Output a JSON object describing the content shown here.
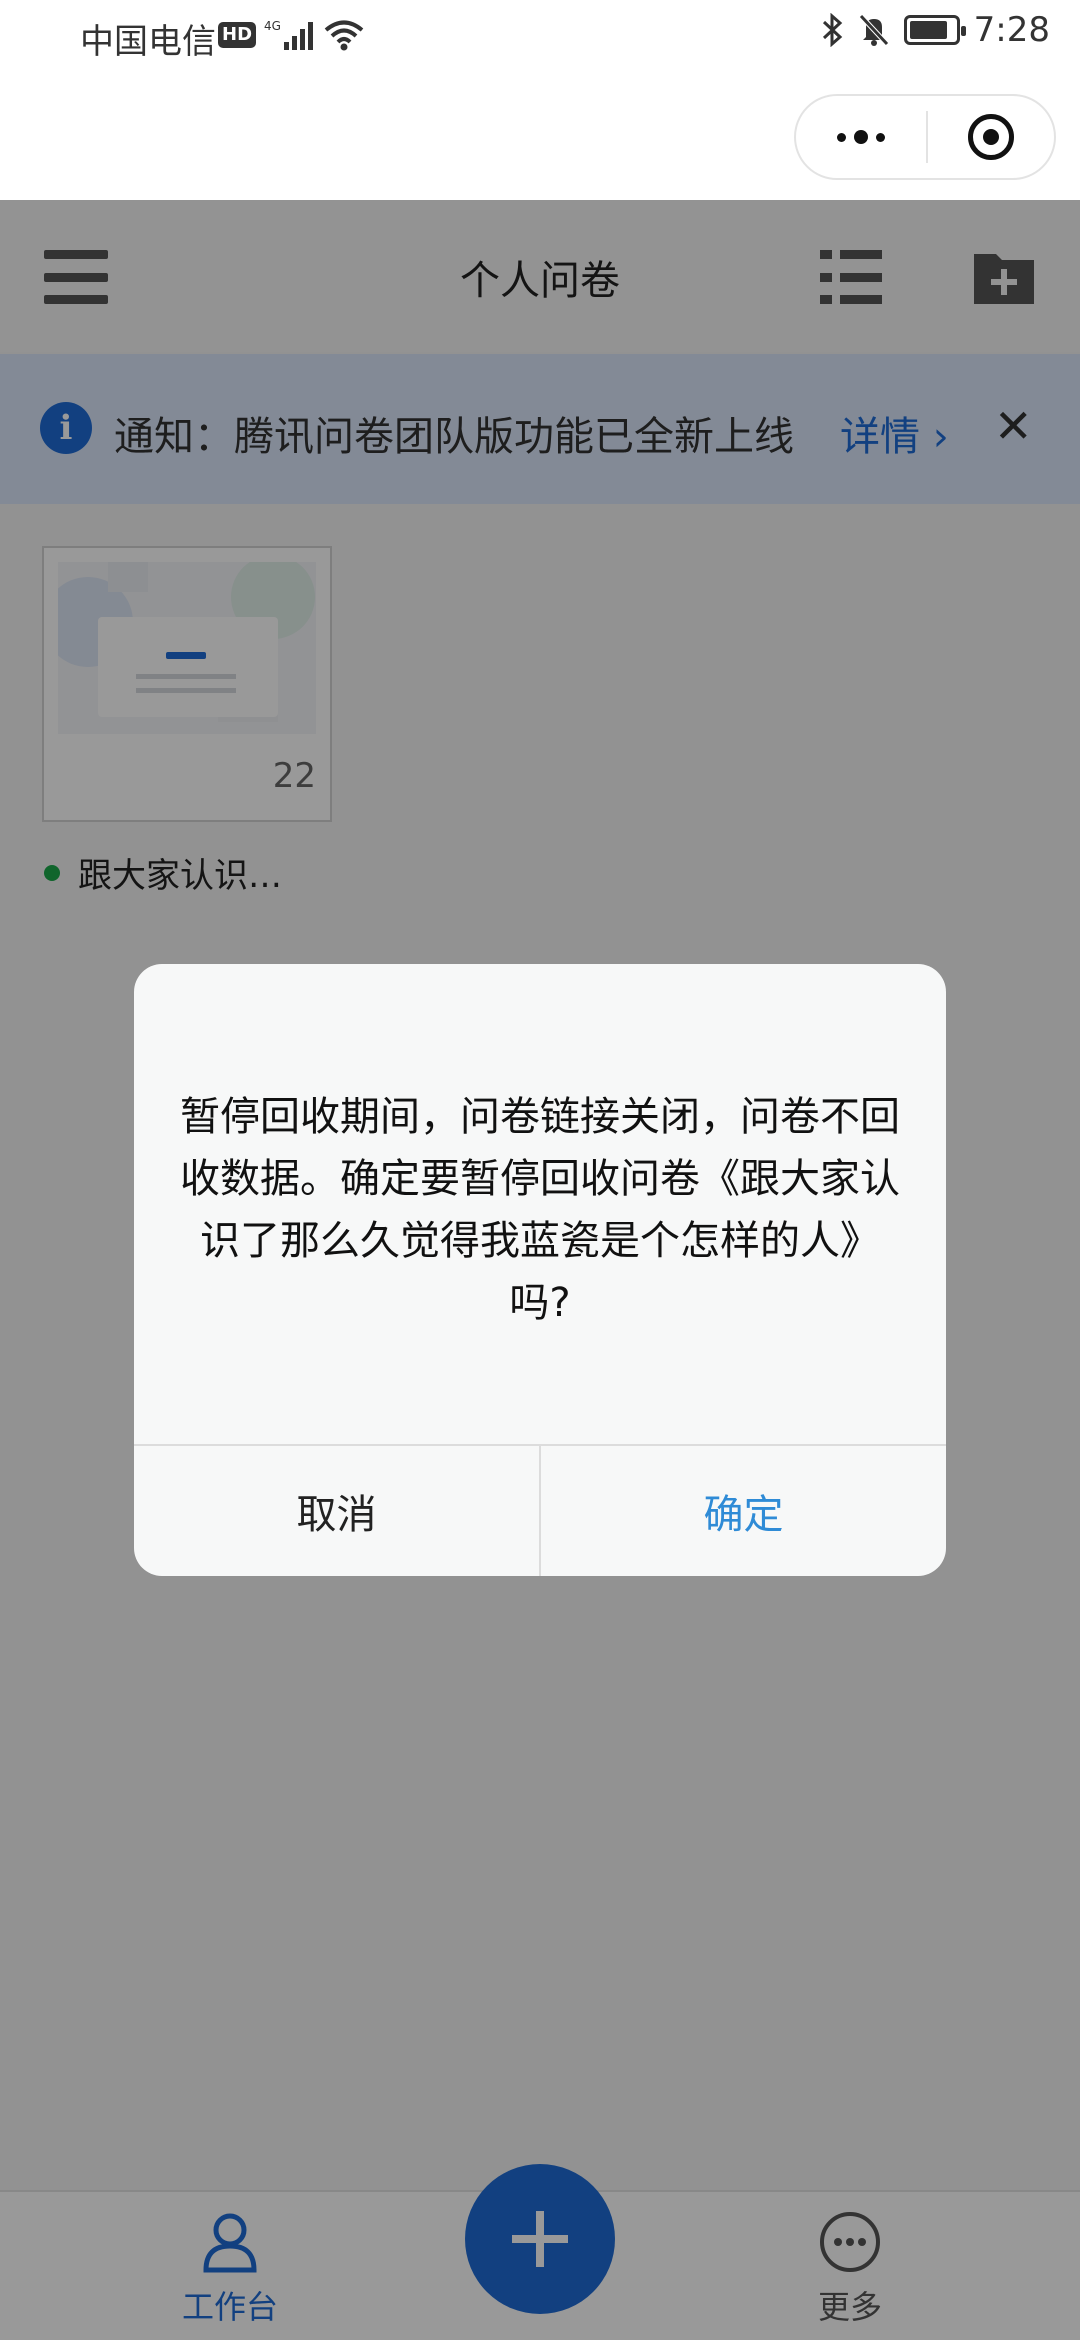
{
  "status_bar": {
    "carrier": "中国电信",
    "hd_badge": "HD",
    "network": "4G",
    "time": "7:28",
    "battery_level": 0.85
  },
  "nav": {
    "title": "个人问卷"
  },
  "notice": {
    "text": "通知：腾讯问卷团队版功能已全新上线",
    "link": "详情 ›",
    "close": "✕"
  },
  "card": {
    "count": "22",
    "title": "跟大家认识…",
    "status_color": "#1ba84a"
  },
  "dialog": {
    "message": "暂停回收期间，问卷链接关闭，问卷不回收数据。确定要暂停回收问卷《跟大家认识了那么久觉得我蓝瓷是个怎样的人》吗?",
    "cancel_label": "取消",
    "confirm_label": "确定"
  },
  "tabbar": {
    "work_label": "工作台",
    "more_label": "更多"
  },
  "colors": {
    "accent": "#1f6cd6",
    "confirm": "#2f8bd6",
    "notice_bg": "#dbe7fb"
  },
  "icons": [
    "menu-icon",
    "list-icon",
    "folder-add-icon",
    "info-icon",
    "close-icon",
    "person-icon",
    "plus-icon",
    "more-icon",
    "bluetooth-icon",
    "mute-icon",
    "wifi-icon",
    "signal-icon",
    "battery-icon"
  ]
}
